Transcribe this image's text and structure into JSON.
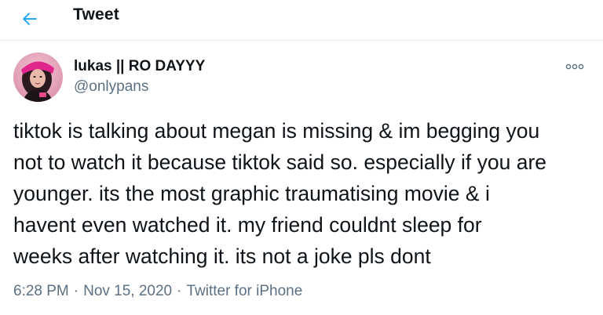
{
  "header": {
    "title": "Tweet"
  },
  "icons": {
    "back": "back-arrow-icon",
    "more": "more-options-icon"
  },
  "colors": {
    "accent": "#1da1f2",
    "secondary_text": "#5b7083",
    "primary_text": "#0f1419",
    "divider": "#e6ecf0"
  },
  "author": {
    "display_name": "lukas || RO DAYYY",
    "handle": "@onlypans"
  },
  "tweet": {
    "text": "tiktok is talking about megan is missing & im begging you\nnot to watch it because tiktok said so. especially if you are\nyounger. its the most graphic traumatising movie & i\nhavent even watched it. my friend couldnt sleep for\nweeks after watching it. its not a joke pls dont",
    "time": "6:28 PM",
    "separator": "·",
    "date": "Nov 15, 2020",
    "source": "Twitter for iPhone"
  }
}
